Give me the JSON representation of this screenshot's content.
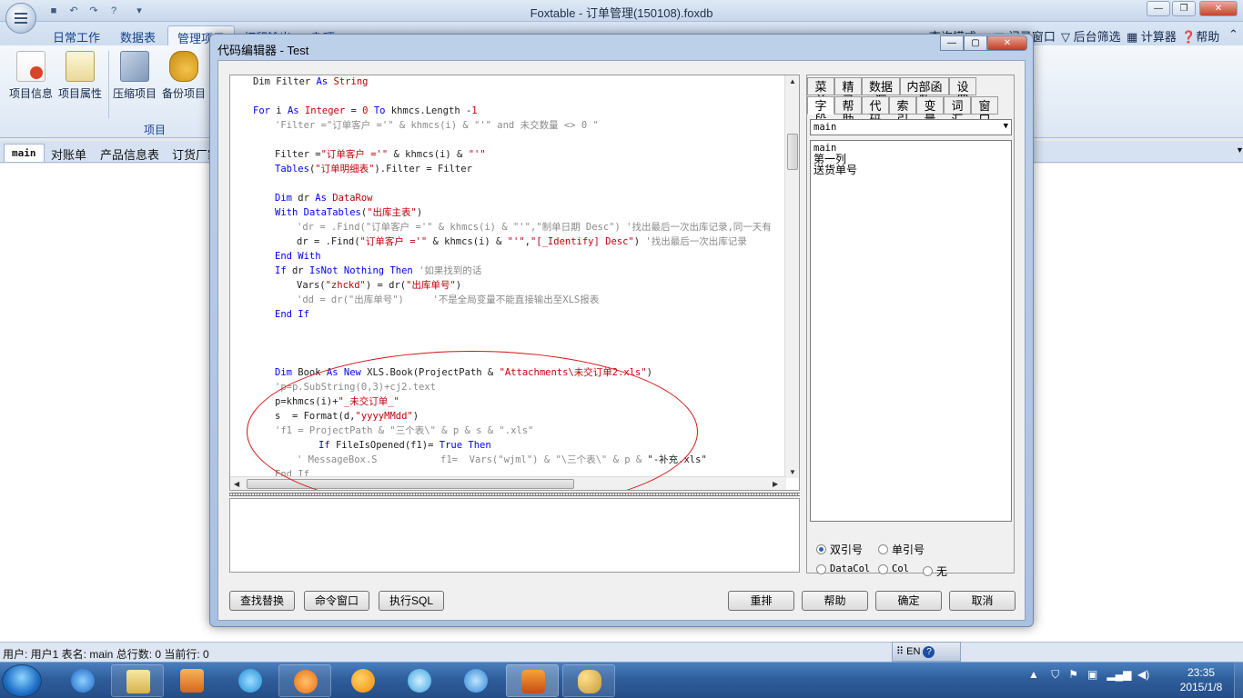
{
  "app": {
    "title": "Foxtable - 订单管理(150108).foxdb",
    "menu_tabs": [
      "日常工作",
      "数据表",
      "管理项目",
      "打印输出",
      "杂项"
    ],
    "right_tools": [
      "查询模式",
      "记录窗口",
      "后台筛选",
      "计算器",
      "帮助"
    ],
    "ribbon_buttons": [
      "项目信息",
      "项目属性",
      "压缩项目",
      "备份项目"
    ],
    "ribbon_group": "项目",
    "table_tabs": [
      "main",
      "对账单",
      "产品信息表",
      "订货厂家"
    ],
    "status": "用户: 用户1 表名: main 总行数: 0 当前行: 0",
    "lang": "EN"
  },
  "dialog": {
    "title": "代码编辑器 - Test",
    "code_lines": [
      {
        "i": 1,
        "parts": [
          [
            "tx",
            "Dim Filter "
          ],
          [
            "kw",
            "As"
          ],
          [
            "tx",
            " "
          ],
          [
            "st",
            "String"
          ]
        ]
      },
      {
        "i": 0,
        "parts": []
      },
      {
        "i": 1,
        "parts": [
          [
            "kw",
            "For"
          ],
          [
            "tx",
            " i "
          ],
          [
            "kw",
            "As"
          ],
          [
            "tx",
            " "
          ],
          [
            "st",
            "Integer"
          ],
          [
            "tx",
            " = "
          ],
          [
            "st",
            "0"
          ],
          [
            "tx",
            " "
          ],
          [
            "kw",
            "To"
          ],
          [
            "tx",
            " khmcs.Length -"
          ],
          [
            "st",
            "1"
          ]
        ]
      },
      {
        "i": 2,
        "parts": [
          [
            "cm",
            "'Filter =\"订单客户 ='\" & khmcs(i) & \"'\" and 未交数量 <> 0 \""
          ]
        ]
      },
      {
        "i": 0,
        "parts": []
      },
      {
        "i": 2,
        "parts": [
          [
            "tx",
            "Filter ="
          ],
          [
            "st",
            "\"订单客户 ='\""
          ],
          [
            "tx",
            " & khmcs(i) & "
          ],
          [
            "st",
            "\"'\""
          ]
        ]
      },
      {
        "i": 2,
        "parts": [
          [
            "kw",
            "Tables"
          ],
          [
            "tx",
            "("
          ],
          [
            "st",
            "\"订单明细表\""
          ],
          [
            "tx",
            ").Filter = Filter"
          ]
        ]
      },
      {
        "i": 0,
        "parts": []
      },
      {
        "i": 2,
        "parts": [
          [
            "kw",
            "Dim"
          ],
          [
            "tx",
            " dr "
          ],
          [
            "kw",
            "As"
          ],
          [
            "tx",
            " "
          ],
          [
            "st",
            "DataRow"
          ]
        ]
      },
      {
        "i": 2,
        "parts": [
          [
            "kw",
            "With"
          ],
          [
            "tx",
            " "
          ],
          [
            "kw",
            "DataTables"
          ],
          [
            "tx",
            "("
          ],
          [
            "st",
            "\"出库主表\""
          ],
          [
            "tx",
            ")"
          ]
        ]
      },
      {
        "i": 3,
        "parts": [
          [
            "cm",
            "'dr = .Find(\"订单客户 ='\" & khmcs(i) & \"'\",\"制单日期 Desc\") '找出最后一次出库记录,同一天有"
          ]
        ]
      },
      {
        "i": 3,
        "parts": [
          [
            "tx",
            "dr = .Find("
          ],
          [
            "st",
            "\"订单客户 ='\""
          ],
          [
            "tx",
            " & khmcs(i) & "
          ],
          [
            "st",
            "\"'\""
          ],
          [
            "tx",
            ","
          ],
          [
            "st",
            "\"[_Identify] Desc\""
          ],
          [
            "tx",
            ") "
          ],
          [
            "cm",
            "'找出最后一次出库记录"
          ]
        ]
      },
      {
        "i": 2,
        "parts": [
          [
            "kw",
            "End With"
          ]
        ]
      },
      {
        "i": 2,
        "parts": [
          [
            "kw",
            "If"
          ],
          [
            "tx",
            " dr "
          ],
          [
            "kw",
            "IsNot Nothing Then"
          ],
          [
            "tx",
            " "
          ],
          [
            "cm",
            "'如果找到的话"
          ]
        ]
      },
      {
        "i": 3,
        "parts": [
          [
            "tx",
            "Vars("
          ],
          [
            "st",
            "\"zhckd\""
          ],
          [
            "tx",
            ") = dr("
          ],
          [
            "st",
            "\"出库单号\""
          ],
          [
            "tx",
            ")"
          ]
        ]
      },
      {
        "i": 3,
        "parts": [
          [
            "cm",
            "'dd = dr(\"出库单号\")     '不是全局变量不能直接输出至XLS报表"
          ]
        ]
      },
      {
        "i": 2,
        "parts": [
          [
            "kw",
            "End If"
          ]
        ]
      },
      {
        "i": 0,
        "parts": []
      },
      {
        "i": 0,
        "parts": []
      },
      {
        "i": 0,
        "parts": []
      },
      {
        "i": 2,
        "parts": [
          [
            "kw",
            "Dim"
          ],
          [
            "tx",
            " Book "
          ],
          [
            "kw",
            "As New"
          ],
          [
            "tx",
            " XLS.Book(ProjectPath & "
          ],
          [
            "st",
            "\"Attachments\\未交订单2.xls\""
          ],
          [
            "tx",
            ")"
          ]
        ]
      },
      {
        "i": 2,
        "parts": [
          [
            "cm",
            "'p=p.SubString(0,3)+cj2.text"
          ]
        ]
      },
      {
        "i": 2,
        "parts": [
          [
            "tx",
            "p=khmcs(i)+"
          ],
          [
            "st",
            "\"_未交订单_\""
          ]
        ]
      },
      {
        "i": 2,
        "parts": [
          [
            "tx",
            "s  = Format(d,"
          ],
          [
            "st",
            "\"yyyyMMdd\""
          ],
          [
            "tx",
            ")"
          ]
        ]
      },
      {
        "i": 2,
        "parts": [
          [
            "cm",
            "'f1 = ProjectPath & \"三个表\\\" & p & s & \".xls\""
          ]
        ]
      },
      {
        "i": 4,
        "parts": [
          [
            "kw",
            "If"
          ],
          [
            "tx",
            " FileIsOpened(f1)= "
          ],
          [
            "kw",
            "True Then"
          ]
        ]
      },
      {
        "i": 3,
        "parts": [
          [
            "cm",
            "' MessageBox.S           f1=  Vars(\"wjml\") & \"\\三个表\\\" & p & "
          ],
          [
            "tx",
            "\"-补充.xls\""
          ]
        ]
      },
      {
        "i": 2,
        "parts": [
          [
            "cm",
            "End If"
          ]
        ]
      }
    ],
    "right_tabs_row1": [
      "菜单",
      "精灵",
      "数据源",
      "内部函数",
      "设置"
    ],
    "right_tabs_row2": [
      "字段",
      "帮助",
      "代码",
      "索引",
      "变量",
      "词汇",
      "窗口"
    ],
    "table_select": "main",
    "fields": [
      "main",
      "第一列",
      "送货单号"
    ],
    "quote_options": [
      "双引号",
      "单引号"
    ],
    "format_options": [
      "DataCol",
      "Col",
      "无"
    ],
    "left_buttons": [
      "查找替换",
      "命令窗口",
      "执行SQL"
    ],
    "right_buttons": [
      "重排",
      "帮助",
      "确定",
      "取消"
    ]
  },
  "taskbar": {
    "time": "23:35",
    "date": "2015/1/8"
  }
}
